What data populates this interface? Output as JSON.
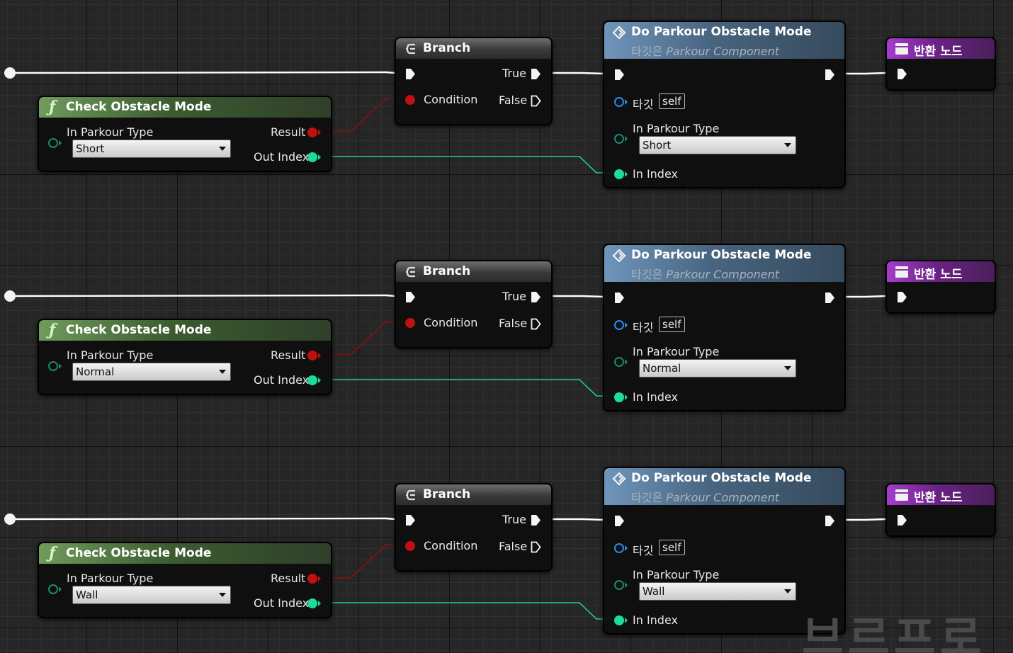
{
  "labels": {
    "branch_title": "Branch",
    "true": "True",
    "false": "False",
    "condition": "Condition",
    "check_title": "Check Obstacle Mode",
    "in_parkour_type": "In Parkour Type",
    "result": "Result",
    "out_index": "Out Index",
    "do_title": "Do Parkour Obstacle Mode",
    "target_prefix": "타깃은",
    "target_class": "Parkour Component",
    "target_pin": "타깃",
    "self": "self",
    "in_index": "In Index",
    "return_title": "반환 노드"
  },
  "rows": [
    {
      "check_type": "Short",
      "do_type": "Short"
    },
    {
      "check_type": "Normal",
      "do_type": "Normal"
    },
    {
      "check_type": "Wall",
      "do_type": "Wall"
    }
  ],
  "watermark": "브르프로",
  "colors": {
    "exec_wire": "#ffffff",
    "bool_wire": "#8a1010",
    "int_wire": "#1ec8a0",
    "function_header": "#3c5c30",
    "call_header": "#48647f",
    "return_header": "#6a2384"
  }
}
